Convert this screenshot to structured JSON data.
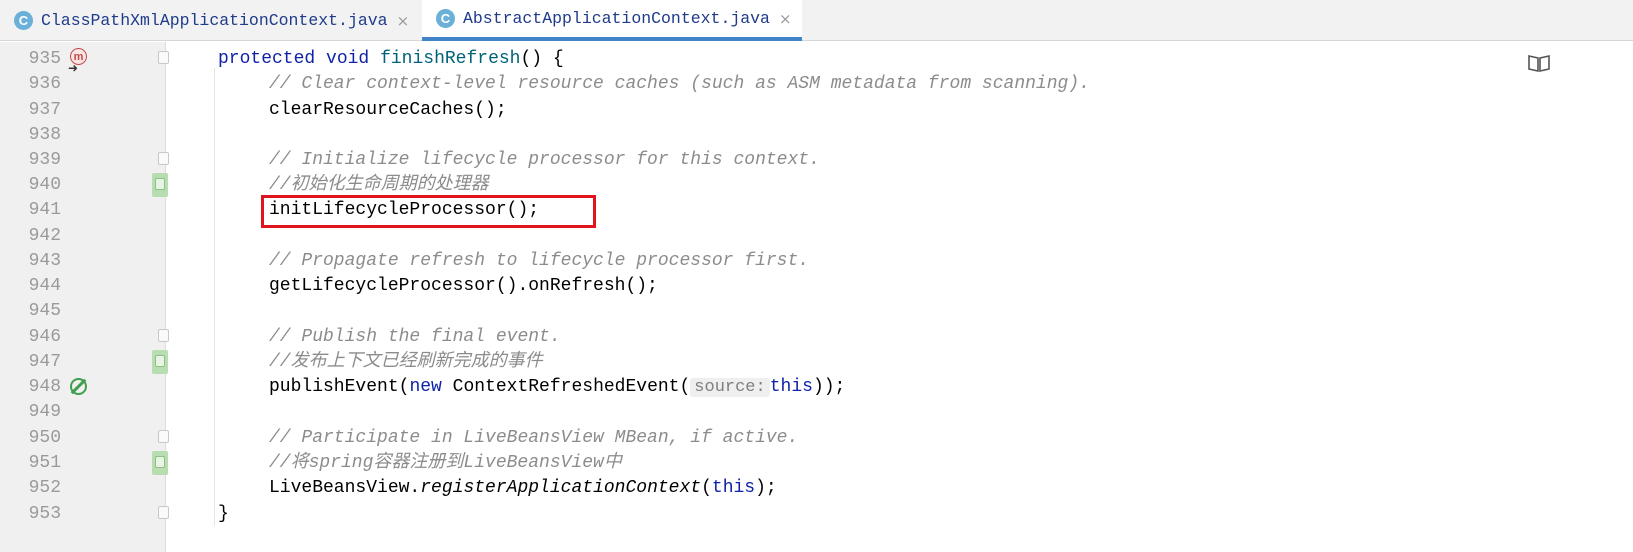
{
  "tabs": [
    {
      "label": "ClassPathXmlApplicationContext.java",
      "icon": "C",
      "active": false
    },
    {
      "label": "AbstractApplicationContext.java",
      "icon": "C",
      "active": true
    }
  ],
  "tab_close_glyph": "×",
  "gutter": {
    "line_numbers": [
      "935",
      "936",
      "937",
      "938",
      "939",
      "940",
      "941",
      "942",
      "943",
      "944",
      "945",
      "946",
      "947",
      "948",
      "949",
      "950",
      "951",
      "952",
      "953"
    ],
    "method_icon_letter": "m",
    "override_arrow_glyph": "➜"
  },
  "code": {
    "l935": {
      "kw1": "protected",
      "kw2": "void",
      "name": "finishRefresh",
      "rest": "() {"
    },
    "l936": "// Clear context-level resource caches (such as ASM metadata from scanning).",
    "l937": "clearResourceCaches();",
    "l939": "// Initialize lifecycle processor for this context.",
    "l940": "//初始化生命周期的处理器",
    "l941": "initLifecycleProcessor();",
    "l943": "// Propagate refresh to lifecycle processor first.",
    "l944": "getLifecycleProcessor().onRefresh();",
    "l946": "// Publish the final event.",
    "l947": "//发布上下文已经刷新完成的事件",
    "l948": {
      "pre": "publishEvent(",
      "kw_new": "new",
      "cls": " ContextRefreshedEvent(",
      "hint": "source:",
      "kw_this": "this",
      "post": "));"
    },
    "l950": "// Participate in LiveBeansView MBean, if active.",
    "l951": "//将spring容器注册到LiveBeansView中",
    "l952": {
      "pre": "LiveBeansView.",
      "method": "registerApplicationContext",
      "open": "(",
      "kw_this": "this",
      "post": ");"
    },
    "l953": "}"
  },
  "colors": {
    "keyword": "#0f23a8",
    "comment": "#8c8c8c",
    "highlight_border": "#e0141e",
    "active_tab_underline": "#4083c9"
  },
  "icons": [
    "class-icon",
    "close-icon",
    "method-override-icon",
    "event-listener-icon",
    "reader-mode-icon",
    "fold-marker-icon"
  ]
}
